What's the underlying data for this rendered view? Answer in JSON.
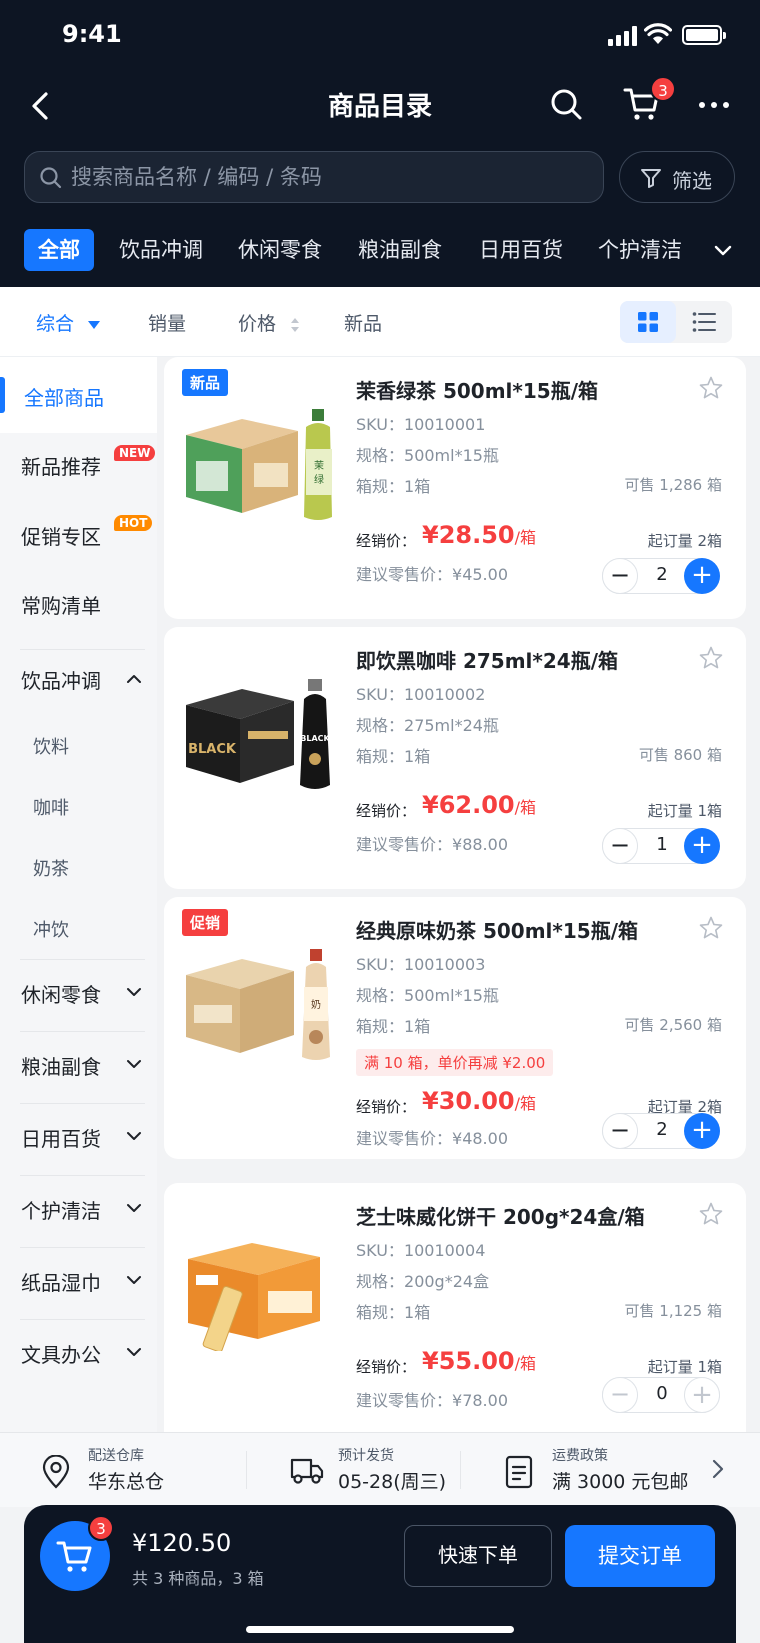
{
  "status": {
    "time": "9:41"
  },
  "nav": {
    "title": "商品目录",
    "cart_badge": "3"
  },
  "search": {
    "placeholder": "搜索商品名称 / 编码 / 条码",
    "filter_label": "筛选"
  },
  "category_tabs": [
    "全部",
    "饮品冲调",
    "休闲零食",
    "粮油副食",
    "日用百货",
    "个护清洁"
  ],
  "sort": {
    "items": [
      "综合",
      "销量",
      "价格",
      "新品"
    ]
  },
  "sidebar": {
    "all": "全部商品",
    "new": "新品推荐",
    "new_badge": "NEW",
    "promo": "促销专区",
    "promo_badge": "HOT",
    "frequent": "常购清单",
    "drinks": "饮品冲调",
    "drinks_sub": [
      "饮料",
      "咖啡",
      "奶茶",
      "冲饮"
    ],
    "groups": [
      "休闲零食",
      "粮油副食",
      "日用百货",
      "个护清洁",
      "纸品湿巾",
      "文具办公"
    ]
  },
  "labels": {
    "sku": "SKU：",
    "spec": "规格：",
    "pack": "箱规：",
    "price": "经销价：",
    "retail": "建议零售价：",
    "unit": "/箱"
  },
  "products": [
    {
      "tag": "新品",
      "name": "茉香绿茶 500ml*15瓶/箱",
      "sku": "10010001",
      "spec": "500ml*15瓶",
      "pack": "1箱",
      "stock": "可售 1,286 箱",
      "price": "¥28.50",
      "retail": "¥45.00",
      "moq": "起订量 2箱",
      "qty": "2"
    },
    {
      "tag": "",
      "name": "即饮黑咖啡 275ml*24瓶/箱",
      "sku": "10010002",
      "spec": "275ml*24瓶",
      "pack": "1箱",
      "stock": "可售 860 箱",
      "price": "¥62.00",
      "retail": "¥88.00",
      "moq": "起订量 1箱",
      "qty": "1"
    },
    {
      "tag": "促销",
      "name": "经典原味奶茶 500ml*15瓶/箱",
      "sku": "10010003",
      "spec": "500ml*15瓶",
      "pack": "1箱",
      "stock": "可售 2,560 箱",
      "promo": "满 10 箱，单价再减 ¥2.00",
      "price": "¥30.00",
      "retail": "¥48.00",
      "moq": "起订量 2箱",
      "qty": "2"
    },
    {
      "tag": "",
      "name": "芝士味威化饼干 200g*24盒/箱",
      "sku": "10010004",
      "spec": "200g*24盒",
      "pack": "1箱",
      "stock": "可售 1,125 箱",
      "price": "¥55.00",
      "retail": "¥78.00",
      "moq": "起订量 1箱",
      "qty": "0"
    }
  ],
  "info": {
    "warehouse_label": "配送仓库",
    "warehouse": "华东总仓",
    "ship_label": "预计发货",
    "ship": "05-28(周三)",
    "freight_label": "运费政策",
    "freight": "满 3000 元包邮"
  },
  "checkout": {
    "badge": "3",
    "total": "¥120.50",
    "summary": "共 3 种商品，3 箱",
    "quick": "快速下单",
    "submit": "提交订单"
  },
  "colors": {
    "primary": "#1677ff",
    "header_bg": "#0d1523",
    "price": "#f53f3f"
  }
}
